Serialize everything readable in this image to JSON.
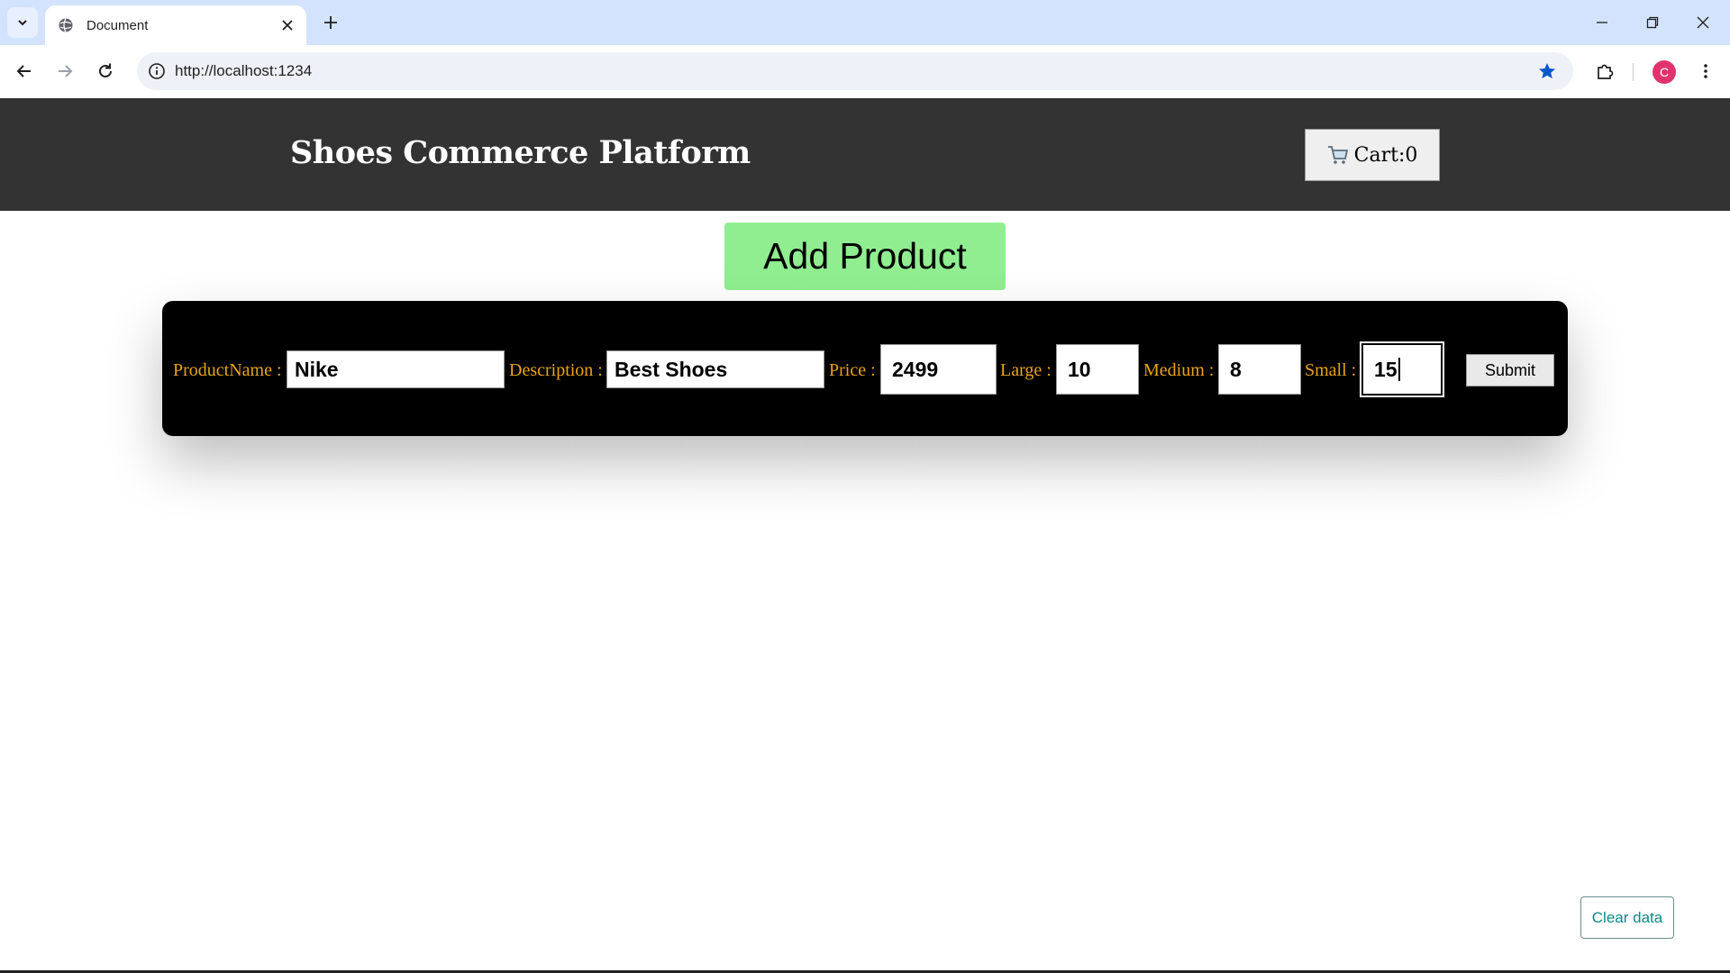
{
  "browser": {
    "tab_title": "Document",
    "url": "http://localhost:1234",
    "profile_initial": "C"
  },
  "header": {
    "title": "Shoes Commerce Platform",
    "cart_label": "Cart:0"
  },
  "add_product_label": "Add Product",
  "form": {
    "product_name_label": "ProductName :",
    "product_name_value": "Nike",
    "description_label": "Description :",
    "description_value": "Best Shoes",
    "price_label": "Price :",
    "price_value": "2499",
    "large_label": "Large :",
    "large_value": "10",
    "medium_label": "Medium :",
    "medium_value": "8",
    "small_label": "Small :",
    "small_value": "15",
    "submit_label": "Submit"
  },
  "clear_data_label": "Clear data",
  "colors": {
    "header_bg": "#333333",
    "add_button_bg": "#90ee90",
    "form_bg": "#000000",
    "label_color": "#e8a317",
    "clear_text": "#0e8a86"
  }
}
